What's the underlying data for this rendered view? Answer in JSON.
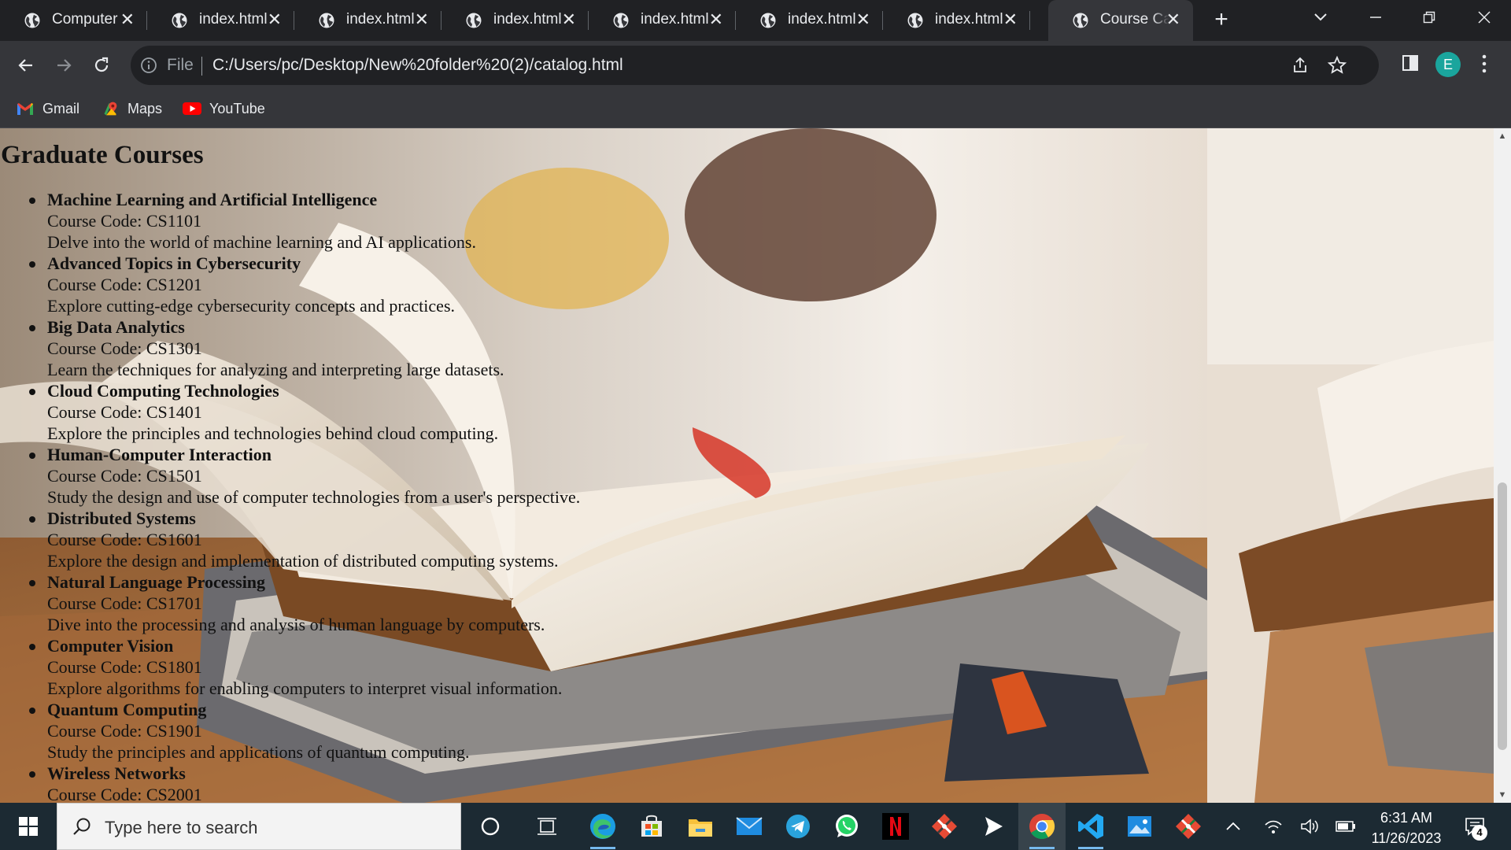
{
  "browser": {
    "tabs": [
      {
        "label": "Computer",
        "active": false
      },
      {
        "label": "index.html",
        "active": false
      },
      {
        "label": "index.html",
        "active": false
      },
      {
        "label": "index.html",
        "active": false
      },
      {
        "label": "index.html",
        "active": false
      },
      {
        "label": "index.html",
        "active": false
      },
      {
        "label": "index.html",
        "active": false
      },
      {
        "label": "Course Catalog",
        "active": true
      }
    ],
    "omnibox": {
      "scheme_label": "File",
      "url": "C:/Users/pc/Desktop/New%20folder%20(2)/catalog.html"
    },
    "profile_initial": "E",
    "bookmarks": [
      {
        "label": "Gmail",
        "icon": "gmail-icon"
      },
      {
        "label": "Maps",
        "icon": "maps-icon"
      },
      {
        "label": "YouTube",
        "icon": "youtube-icon"
      }
    ]
  },
  "page": {
    "title": "Graduate Courses",
    "courses": [
      {
        "name": "Machine Learning and Artificial Intelligence",
        "code": "Course Code: CS1101",
        "description": "Delve into the world of machine learning and AI applications."
      },
      {
        "name": "Advanced Topics in Cybersecurity",
        "code": "Course Code: CS1201",
        "description": "Explore cutting-edge cybersecurity concepts and practices."
      },
      {
        "name": "Big Data Analytics",
        "code": "Course Code: CS1301",
        "description": "Learn the techniques for analyzing and interpreting large datasets."
      },
      {
        "name": "Cloud Computing Technologies",
        "code": "Course Code: CS1401",
        "description": "Explore the principles and technologies behind cloud computing."
      },
      {
        "name": "Human-Computer Interaction",
        "code": "Course Code: CS1501",
        "description": "Study the design and use of computer technologies from a user's perspective."
      },
      {
        "name": "Distributed Systems",
        "code": "Course Code: CS1601",
        "description": "Explore the design and implementation of distributed computing systems."
      },
      {
        "name": "Natural Language Processing",
        "code": "Course Code: CS1701",
        "description": "Dive into the processing and analysis of human language by computers."
      },
      {
        "name": "Computer Vision",
        "code": "Course Code: CS1801",
        "description": "Explore algorithms for enabling computers to interpret visual information."
      },
      {
        "name": "Quantum Computing",
        "code": "Course Code: CS1901",
        "description": "Study the principles and applications of quantum computing."
      },
      {
        "name": "Wireless Networks",
        "code": "Course Code: CS2001",
        "description": ""
      }
    ]
  },
  "taskbar": {
    "search_placeholder": "Type here to search",
    "apps": [
      "cortana-icon",
      "task-view-icon",
      "edge-icon",
      "store-icon",
      "file-explorer-icon",
      "mail-icon",
      "telegram-icon",
      "whatsapp-icon",
      "netflix-icon",
      "git-icon",
      "media-player-icon",
      "chrome-icon",
      "vscode-icon",
      "photos-icon",
      "git-gui-icon"
    ],
    "time": "6:31 AM",
    "date": "11/26/2023",
    "notification_count": "4"
  },
  "colors": {
    "chrome_dark": "#202124",
    "chrome_toolbar": "#35363a",
    "profile_avatar": "#1aa59d",
    "taskbar": "#1c2a33"
  }
}
